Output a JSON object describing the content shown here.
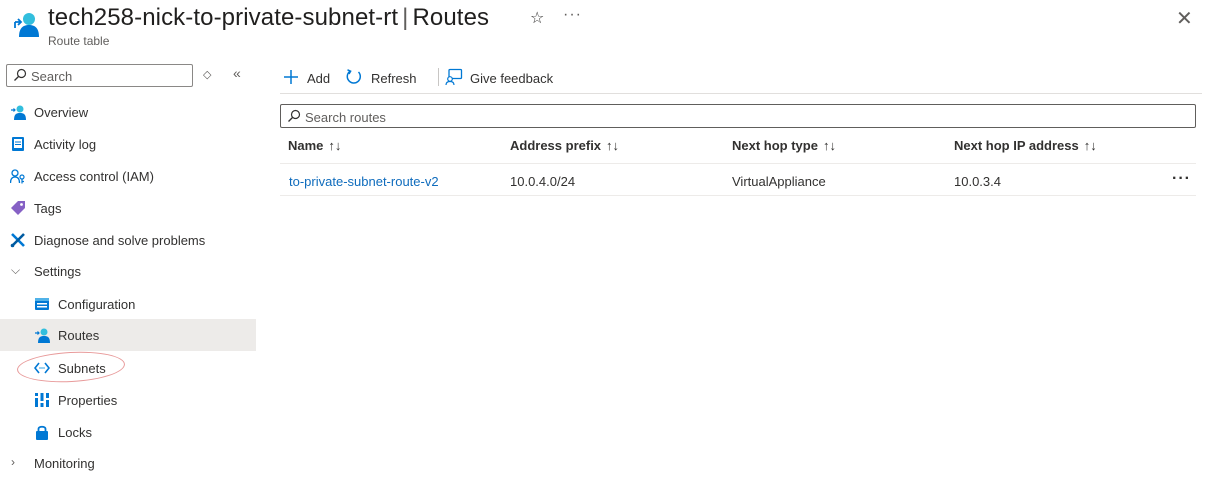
{
  "header": {
    "resource_name": "tech258-nick-to-private-subnet-rt",
    "separator": "|",
    "page_name": "Routes",
    "resource_type": "Route table"
  },
  "sidebar": {
    "search_placeholder": "Search",
    "items": [
      {
        "label": "Overview",
        "icon": "route-table-icon"
      },
      {
        "label": "Activity log",
        "icon": "activity-log-icon"
      },
      {
        "label": "Access control (IAM)",
        "icon": "iam-icon"
      },
      {
        "label": "Tags",
        "icon": "tag-icon"
      },
      {
        "label": "Diagnose and solve problems",
        "icon": "wrench-icon"
      },
      {
        "label": "Settings",
        "icon": "chevron-down-icon",
        "expanded": true
      },
      {
        "label": "Configuration",
        "icon": "configuration-icon"
      },
      {
        "label": "Routes",
        "icon": "route-table-icon",
        "selected": true
      },
      {
        "label": "Subnets",
        "icon": "subnet-icon"
      },
      {
        "label": "Properties",
        "icon": "properties-icon"
      },
      {
        "label": "Locks",
        "icon": "lock-icon"
      },
      {
        "label": "Monitoring",
        "icon": "chevron-right-icon",
        "expanded": false
      }
    ]
  },
  "toolbar": {
    "add_label": "Add",
    "refresh_label": "Refresh",
    "feedback_label": "Give feedback"
  },
  "routes": {
    "search_placeholder": "Search routes",
    "columns": [
      "Name",
      "Address prefix",
      "Next hop type",
      "Next hop IP address"
    ],
    "sort_glyph": "↑↓",
    "rows": [
      {
        "name": "to-private-subnet-route-v2",
        "address_prefix": "10.0.4.0/24",
        "next_hop_type": "VirtualAppliance",
        "next_hop_ip": "10.0.3.4"
      }
    ]
  },
  "colors": {
    "link": "#0f6cbd",
    "azure_blue": "#0078d4",
    "selected_bg": "#edebe9",
    "annotation": "#e89a9a"
  }
}
